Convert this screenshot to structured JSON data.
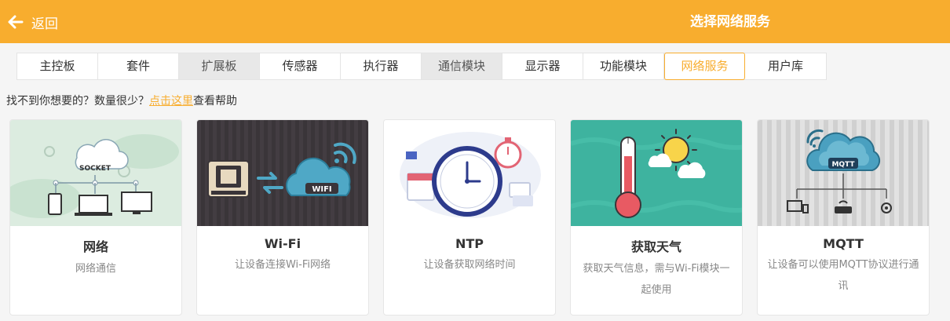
{
  "header": {
    "back_label": "返回",
    "title": "选择网络服务"
  },
  "tabs": [
    {
      "label": "主控板"
    },
    {
      "label": "套件"
    },
    {
      "label": "扩展板"
    },
    {
      "label": "传感器"
    },
    {
      "label": "执行器"
    },
    {
      "label": "通信模块"
    },
    {
      "label": "显示器"
    },
    {
      "label": "功能模块"
    },
    {
      "label": "网络服务",
      "active": true
    },
    {
      "label": "用户库"
    }
  ],
  "help": {
    "prefix": "找不到你想要的？数量很少？",
    "link": "点击这里",
    "suffix": "查看帮助"
  },
  "cards": [
    {
      "name": "网络",
      "desc": "网络通信",
      "image_label": "SOCKET",
      "icon": "socket-network-illustration"
    },
    {
      "name": "Wi-Fi",
      "desc": "让设备连接Wi-Fi网络",
      "image_label": "WIFI",
      "icon": "wifi-cloud-illustration"
    },
    {
      "name": "NTP",
      "desc": "让设备获取网络时间",
      "icon": "clock-illustration"
    },
    {
      "name": "获取天气",
      "desc": "获取天气信息，需与Wi-Fi模块一起使用",
      "icon": "weather-thermometer-illustration"
    },
    {
      "name": "MQTT",
      "desc": "让设备可以使用MQTT协议进行通讯",
      "image_label": "MQTT",
      "icon": "mqtt-cloud-illustration"
    }
  ],
  "colors": {
    "accent": "#f8ad2e",
    "card1_bg": "#dcece0",
    "card2_bg": "#3a3539",
    "card4_bg": "#3eb39f"
  }
}
